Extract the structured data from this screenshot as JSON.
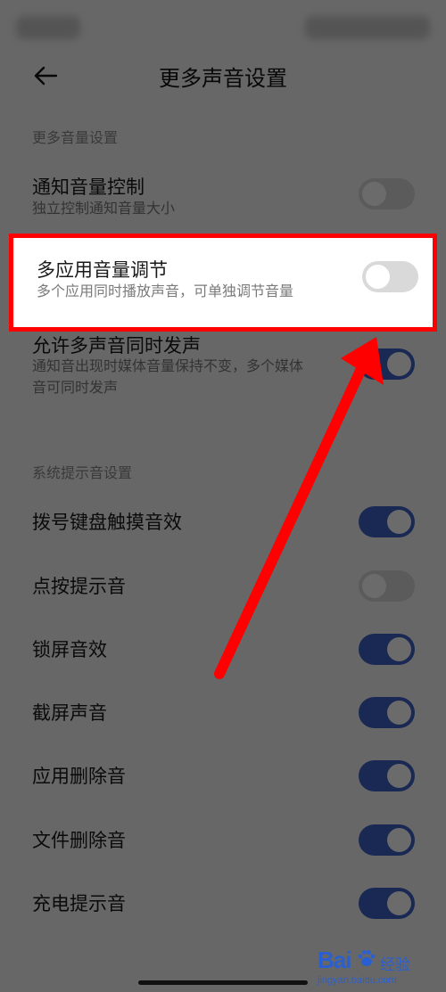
{
  "header": {
    "title": "更多声音设置",
    "back_icon": "back-arrow-icon"
  },
  "sections": {
    "more_volume": {
      "header": "更多音量设置",
      "items": [
        {
          "title": "通知音量控制",
          "subtitle": "独立控制通知音量大小",
          "enabled": false
        },
        {
          "title": "多应用音量调节",
          "subtitle": "多个应用同时播放声音，可单独调节音量",
          "enabled": false
        },
        {
          "title": "允许多声音同时发声",
          "subtitle_line1": "通知音出现时媒体音量保持不变，多个媒体",
          "subtitle_line2": "音可同时发声",
          "enabled": true
        }
      ]
    },
    "system_tones": {
      "header": "系统提示音设置",
      "items": [
        {
          "title": "拨号键盘触摸音效",
          "enabled": true
        },
        {
          "title": "点按提示音",
          "enabled": false
        },
        {
          "title": "锁屏音效",
          "enabled": true
        },
        {
          "title": "截屏声音",
          "enabled": true
        },
        {
          "title": "应用删除音",
          "enabled": true
        },
        {
          "title": "文件删除音",
          "enabled": true
        },
        {
          "title": "充电提示音",
          "enabled": true
        }
      ]
    }
  },
  "annotation": {
    "highlight_color": "#ff0000",
    "arrow_color": "#ff0000"
  },
  "colors": {
    "toggle_on": "#3f62c7",
    "toggle_off": "#d9d9d9",
    "background": "#f5f5f5"
  },
  "watermark": {
    "logo": "Bai",
    "brand": "经验",
    "url": "jingyan.baidu.com"
  }
}
